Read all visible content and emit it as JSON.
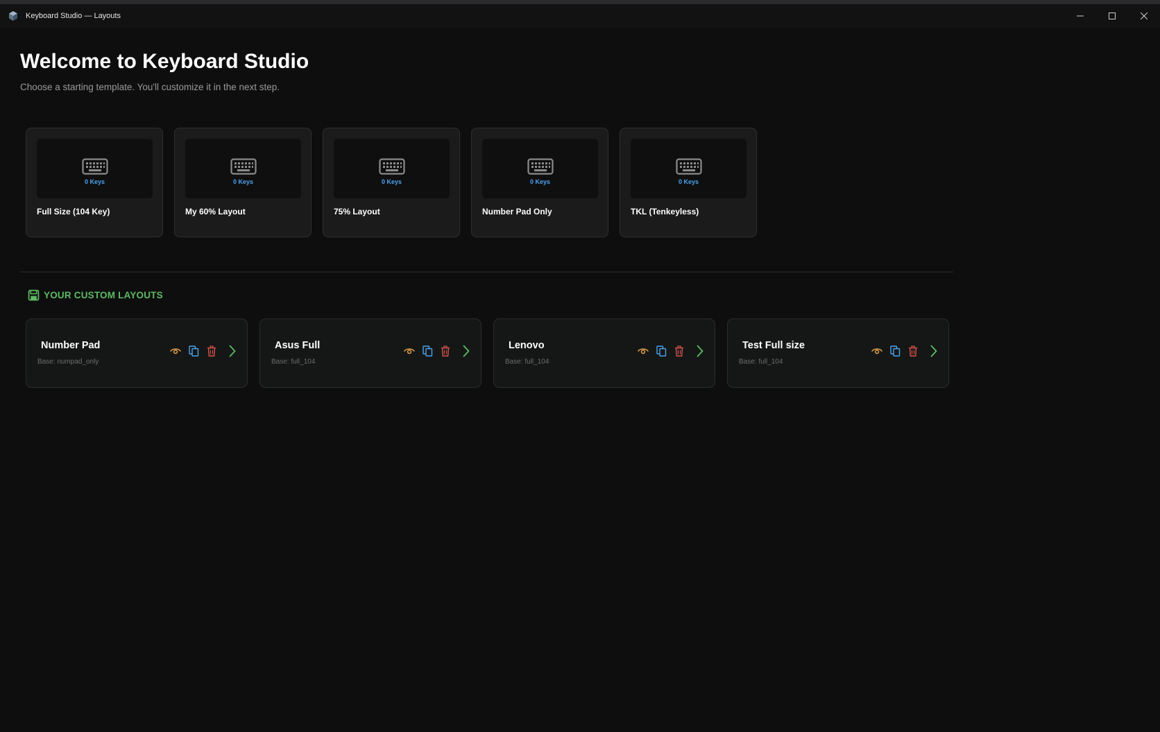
{
  "window": {
    "title": "Keyboard Studio — Layouts",
    "icon": "cube-icon"
  },
  "header": {
    "title": "Welcome to Keyboard Studio",
    "subtitle": "Choose a starting template. You'll customize it in the next step."
  },
  "templates": [
    {
      "name": "Full Size (104 Key)",
      "keys": "0 Keys"
    },
    {
      "name": "My 60% Layout",
      "keys": "0 Keys"
    },
    {
      "name": "75% Layout",
      "keys": "0 Keys"
    },
    {
      "name": "Number Pad Only",
      "keys": "0 Keys"
    },
    {
      "name": "TKL (Tenkeyless)",
      "keys": "0 Keys"
    }
  ],
  "custom_section": {
    "title": "YOUR CUSTOM LAYOUTS",
    "icon": "save-icon"
  },
  "custom_layouts": [
    {
      "name": "Number Pad",
      "base": "Base: numpad_only"
    },
    {
      "name": "Asus Full",
      "base": "Base: full_104"
    },
    {
      "name": "Lenovo",
      "base": "Base: full_104"
    },
    {
      "name": "Test Full size",
      "base": "Base: full_104"
    }
  ],
  "colors": {
    "background": "#0e0e0f",
    "accent_green": "#5dbb63",
    "key_count_blue": "#4aa3ee",
    "preview_orange": "#e5a04a",
    "copy_blue": "#4aa3ee",
    "delete_red": "#d9534f"
  }
}
